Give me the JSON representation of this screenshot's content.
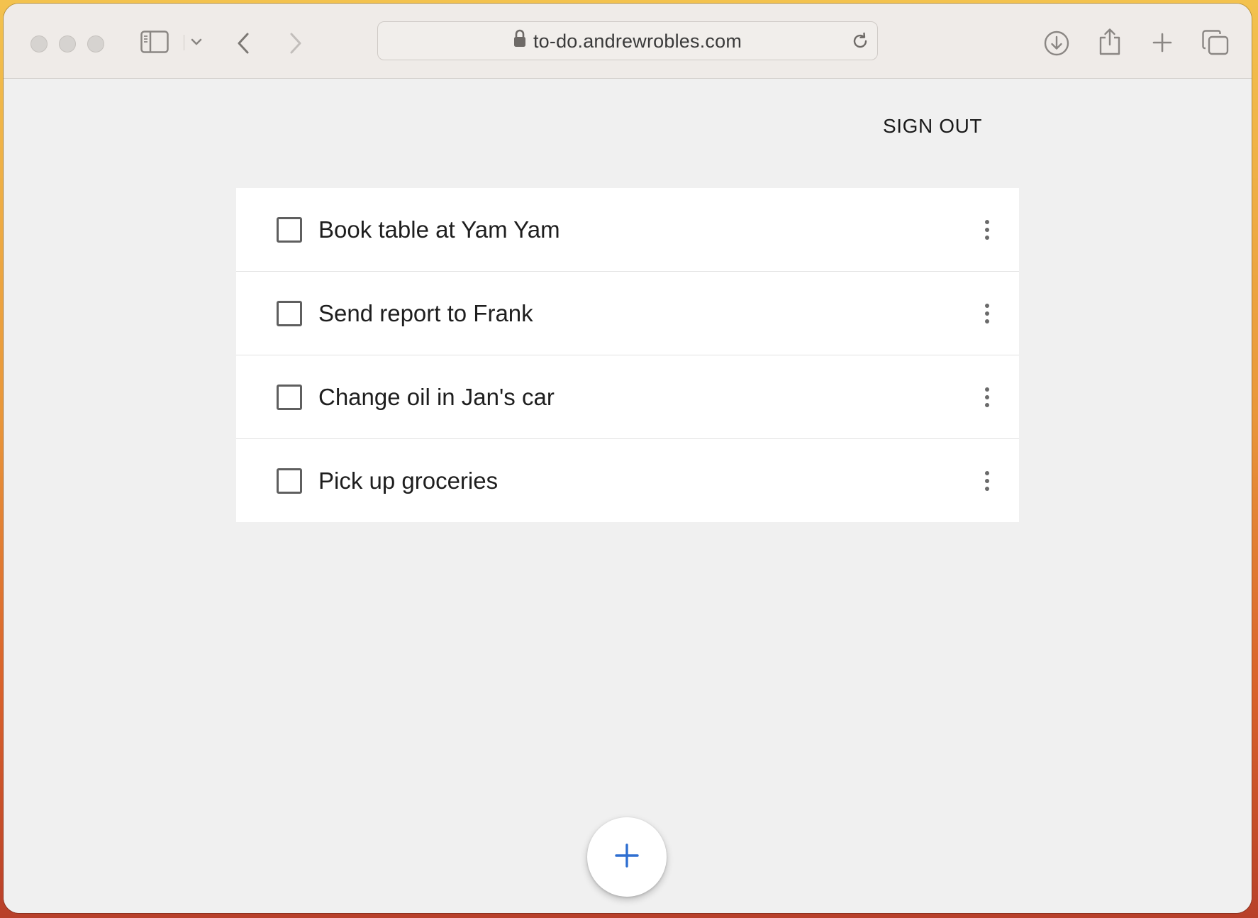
{
  "browser": {
    "url": "to-do.andrewrobles.com",
    "icons": [
      "sidebar-icon",
      "chevron-down-icon",
      "back-icon",
      "forward-icon",
      "lock-icon",
      "reload-icon",
      "download-icon",
      "share-icon",
      "new-tab-icon",
      "tabs-overview-icon"
    ]
  },
  "header": {
    "sign_out_label": "SIGN OUT"
  },
  "todos": [
    {
      "label": "Book table at Yam Yam",
      "checked": false
    },
    {
      "label": "Send report to Frank",
      "checked": false
    },
    {
      "label": "Change oil in Jan's car",
      "checked": false
    },
    {
      "label": "Pick up groceries",
      "checked": false
    }
  ],
  "fab": {
    "icon": "plus-icon",
    "color": "#2f6fd1"
  },
  "colors": {
    "accent": "#2f6fd1",
    "page_background": "#f0f0f0",
    "list_background": "#ffffff"
  }
}
